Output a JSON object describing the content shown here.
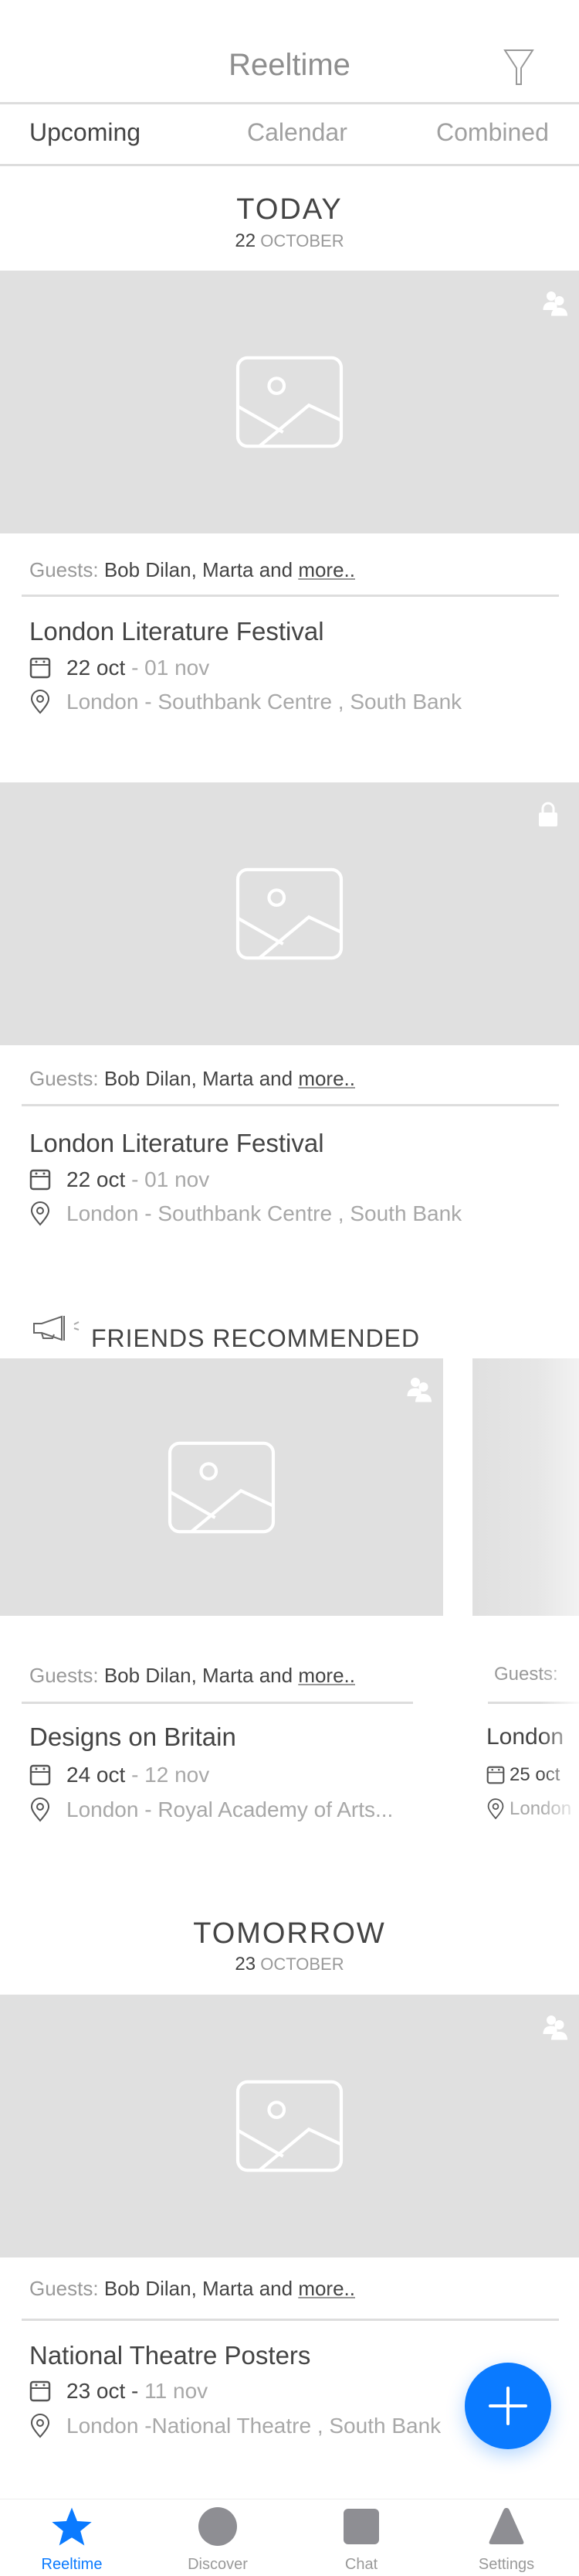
{
  "header": {
    "title": "Reeltime",
    "filter_icon": "filter-icon"
  },
  "tabs": [
    {
      "label": "Upcoming",
      "active": true
    },
    {
      "label": "Calendar"
    },
    {
      "label": "Combined"
    }
  ],
  "sections": {
    "today": {
      "label": "TODAY",
      "day": "22",
      "month": "OCTOBER"
    },
    "friends": {
      "label": "FRIENDS RECOMMENDED"
    },
    "tomorrow": {
      "label": "TOMORROW",
      "day": "23",
      "month": "OCTOBER"
    }
  },
  "guests": {
    "label": "Guests:",
    "names": "Bob Dilan, Marta and",
    "more": "more.."
  },
  "events": [
    {
      "title": "London Literature Festival",
      "start": "22 oct",
      "end": "- 01 nov",
      "location": "London - Southbank Centre , South Bank",
      "badge": "group-icon"
    },
    {
      "title": "London Literature Festival",
      "start": "22 oct",
      "end": "- 01 nov",
      "location": "London - Southbank Centre , South Bank",
      "badge": "lock-icon"
    },
    {
      "title": "Designs on Britain",
      "start": "24 oct",
      "end": "- 12 nov",
      "location": "London - Royal Academy of Arts...",
      "badge": "group-icon"
    },
    {
      "title": "London",
      "start": "25 oct",
      "end": "",
      "location": "London",
      "guests_label": "Guests:"
    },
    {
      "title": "National Theatre Posters",
      "start": "23 oct -",
      "end": "11 nov",
      "location": "London -National Theatre , South Bank",
      "badge": "group-icon"
    }
  ],
  "tabbar": [
    {
      "label": "Reeltime",
      "active": true
    },
    {
      "label": "Discover"
    },
    {
      "label": "Chat"
    },
    {
      "label": "Settings"
    }
  ],
  "colors": {
    "accent": "#0a7aff",
    "placeholder": "#e0e0e0",
    "inactive_icon": "#8e8e93"
  }
}
